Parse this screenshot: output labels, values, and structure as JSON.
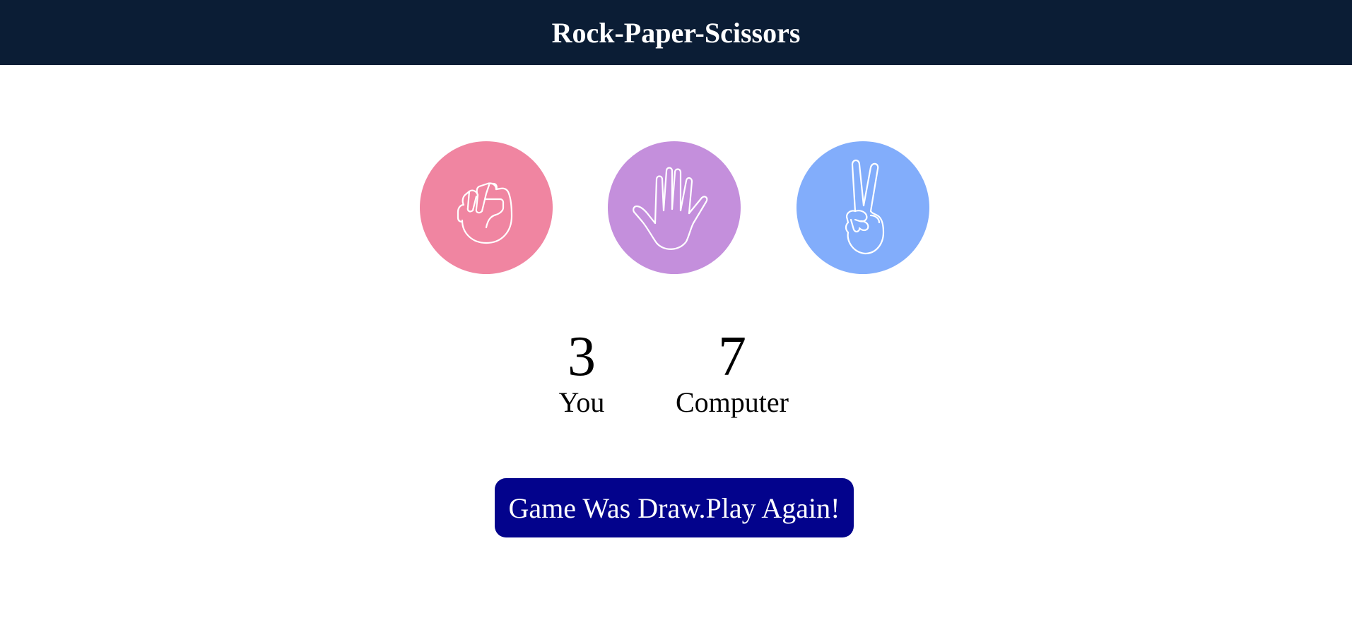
{
  "header": {
    "title": "Rock-Paper-Scissors",
    "background": "#0b1d35"
  },
  "choices": [
    {
      "id": "rock",
      "icon": "fist-icon",
      "color": "#f085a1"
    },
    {
      "id": "paper",
      "icon": "open-hand-icon",
      "color": "#c48fdc"
    },
    {
      "id": "scissors",
      "icon": "peace-hand-icon",
      "color": "#82adfb"
    }
  ],
  "score": {
    "you": {
      "value": "3",
      "label": "You"
    },
    "computer": {
      "value": "7",
      "label": "Computer"
    }
  },
  "result": {
    "button_label": "Game Was Draw.Play Again!",
    "button_color": "#03038c"
  }
}
